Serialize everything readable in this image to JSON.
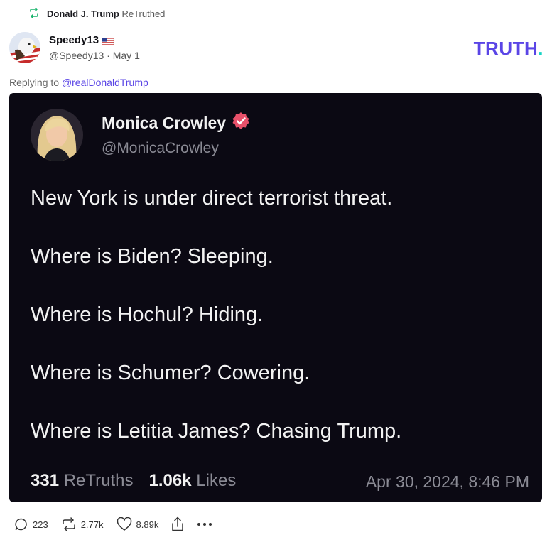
{
  "retruth": {
    "name": "Donald J. Trump",
    "verb": "ReTruthed"
  },
  "author": {
    "display_name": "Speedy13",
    "handle": "@Speedy13",
    "date": "May 1"
  },
  "brand": {
    "logo": "TRUTH",
    "logo_dot": ".",
    "color": "#5a45e6",
    "dot_color": "#17d4c5"
  },
  "reply": {
    "prefix": "Replying to",
    "mention": "@realDonaldTrump"
  },
  "embed": {
    "name": "Monica Crowley",
    "handle": "@MonicaCrowley",
    "lines": [
      "New York is under direct terrorist threat.",
      "Where is Biden?  Sleeping.",
      "Where is Hochul?  Hiding.",
      "Where is Schumer?  Cowering.",
      "Where is Letitia James?  Chasing Trump."
    ],
    "retruths_count": "331",
    "retruths_label": "ReTruths",
    "likes_count": "1.06k",
    "likes_label": "Likes",
    "timestamp": "Apr 30, 2024, 8:46 PM"
  },
  "actions": {
    "replies": "223",
    "retruths": "2.77k",
    "likes": "8.89k"
  },
  "icons": [
    "retruth-icon",
    "us-flag-icon",
    "verified-badge-icon",
    "reply-icon",
    "like-icon",
    "share-icon",
    "more-icon"
  ]
}
